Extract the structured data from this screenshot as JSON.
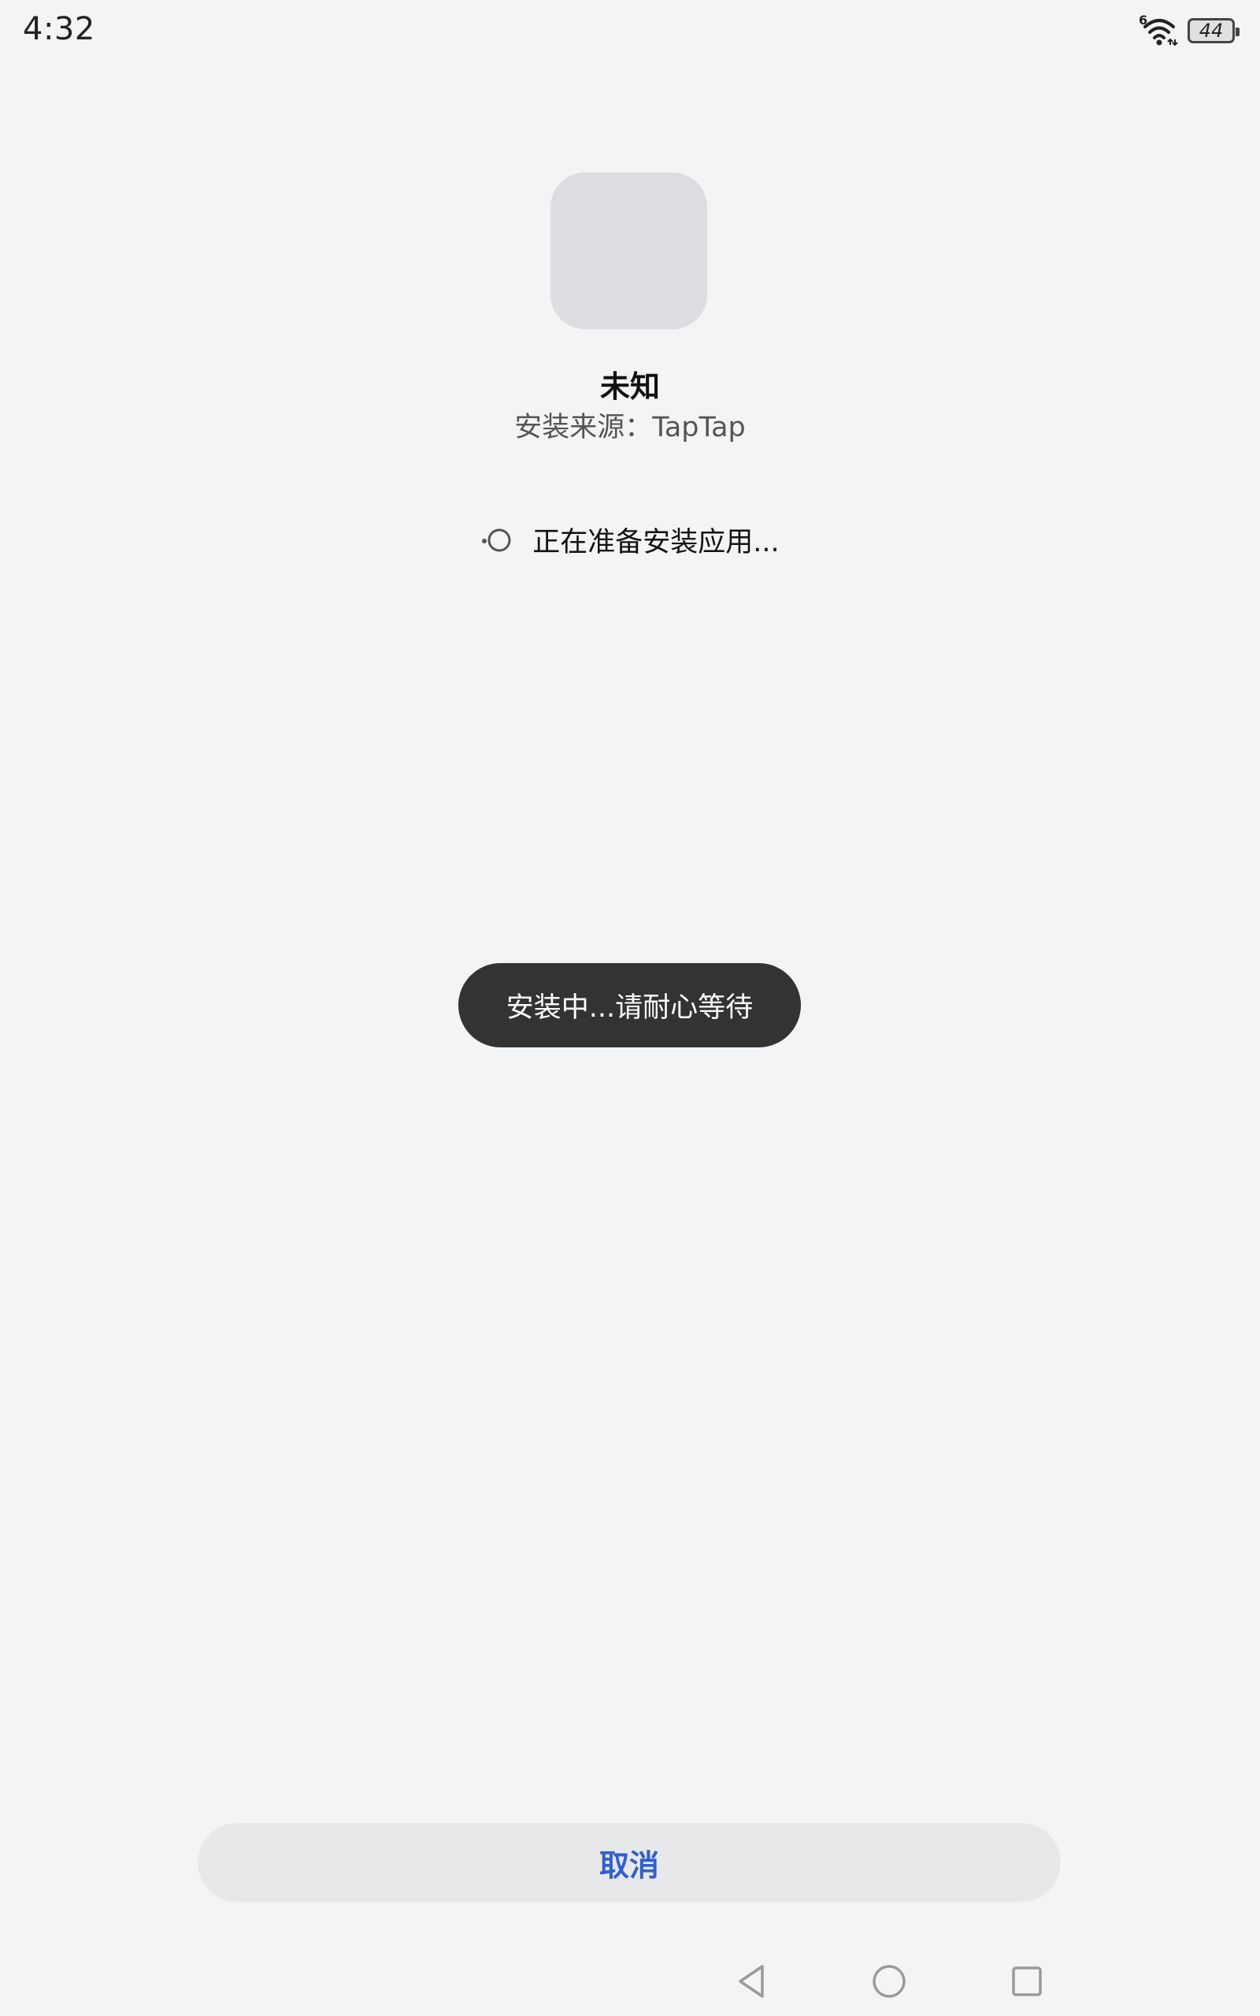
{
  "status_bar": {
    "time": "4:32",
    "network_label": "6",
    "battery_level": "44"
  },
  "app": {
    "name": "未知",
    "source": "安装来源：TapTap"
  },
  "progress": {
    "text": "正在准备安装应用..."
  },
  "toast": {
    "text": "安装中...请耐心等待"
  },
  "actions": {
    "cancel_label": "取消"
  },
  "colors": {
    "background": "#f3f4f6",
    "accent": "#2f5fd0",
    "toast_bg": "#333333",
    "icon_placeholder": "#dcdde0"
  },
  "icons": {
    "wifi": "wifi-icon",
    "battery": "battery-icon",
    "spinner": "spinner-icon",
    "back": "back-triangle-icon",
    "home": "home-circle-icon",
    "recent": "recent-square-icon"
  }
}
